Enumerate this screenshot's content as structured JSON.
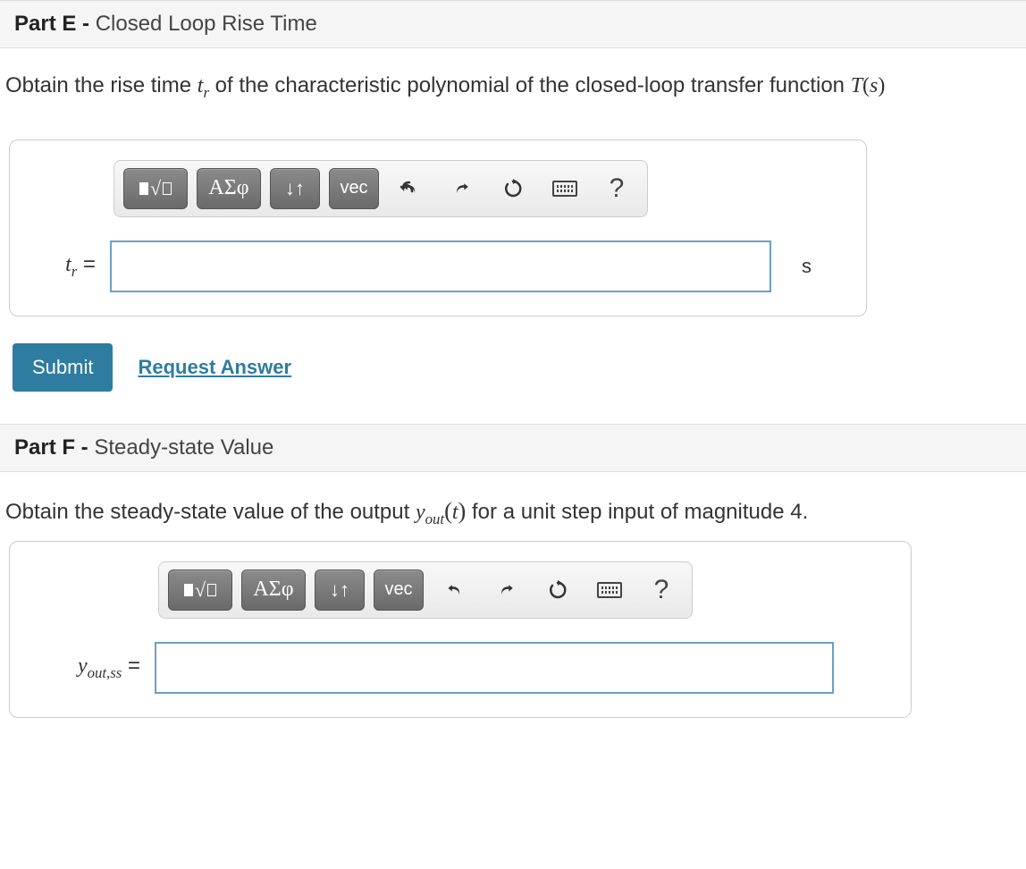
{
  "partE": {
    "header_bold": "Part E -",
    "header_rest": " Closed Loop Rise Time",
    "prompt_before": "Obtain the rise time ",
    "prompt_var": "t",
    "prompt_var_sub": "r",
    "prompt_after1": " of the characteristic polynomial of the closed-loop transfer function ",
    "prompt_func": "T",
    "prompt_arg": "s",
    "lhs_var": "t",
    "lhs_sub": "r",
    "lhs_eq": " =",
    "unit": "s",
    "input_value": ""
  },
  "toolbar": {
    "greek_label": "ΑΣφ",
    "subsup_label": "↓↑",
    "vec_label": "vec",
    "help_label": "?"
  },
  "actions": {
    "submit": "Submit",
    "request": "Request Answer"
  },
  "partF": {
    "header_bold": "Part F -",
    "header_rest": " Steady-state Value",
    "prompt_before": "Obtain the steady-state value of the output ",
    "prompt_var": "y",
    "prompt_var_sub": "out",
    "prompt_arg": "t",
    "prompt_after": " for a unit step input of magnitude 4.",
    "lhs_var": "y",
    "lhs_sub": "out,ss",
    "lhs_eq": " =",
    "input_value": ""
  }
}
